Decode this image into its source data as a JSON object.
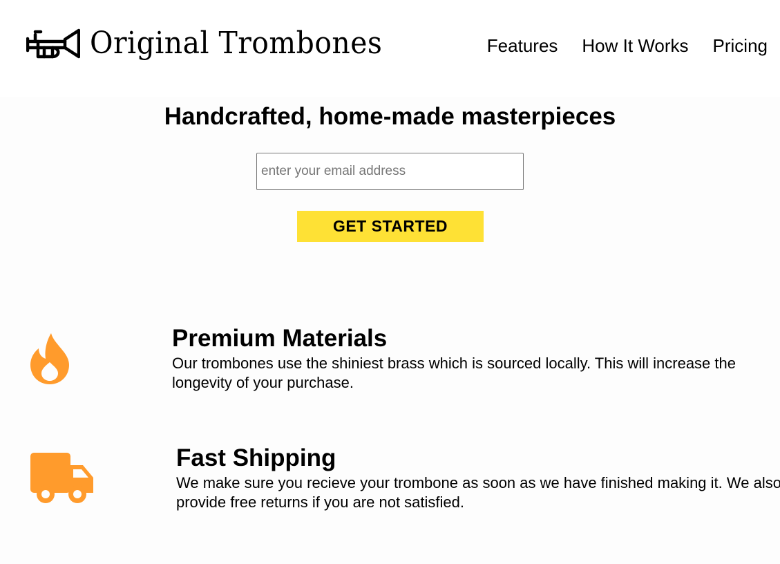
{
  "brand": {
    "name": "Original Trombones",
    "icon": "trombone-logo-icon"
  },
  "nav": {
    "items": [
      {
        "label": "Features"
      },
      {
        "label": "How It Works"
      },
      {
        "label": "Pricing"
      }
    ]
  },
  "hero": {
    "title": "Handcrafted, home-made masterpieces",
    "email_placeholder": "enter your email address",
    "email_value": "",
    "cta_label": "GET STARTED"
  },
  "features": [
    {
      "icon": "fire-icon",
      "title": "Premium Materials",
      "description": "Our trombones use the shiniest brass which is sourced locally. This will increase the longevity of your purchase."
    },
    {
      "icon": "truck-icon",
      "title": "Fast Shipping",
      "description": "We make sure you recieve your trombone as soon as we have finished making it. We also provide free returns if you are not satisfied."
    }
  ],
  "colors": {
    "accent_yellow": "#fee135",
    "icon_orange": "#ff9b2c",
    "page_background": "#fdfdfd",
    "header_background": "#ffffff"
  }
}
